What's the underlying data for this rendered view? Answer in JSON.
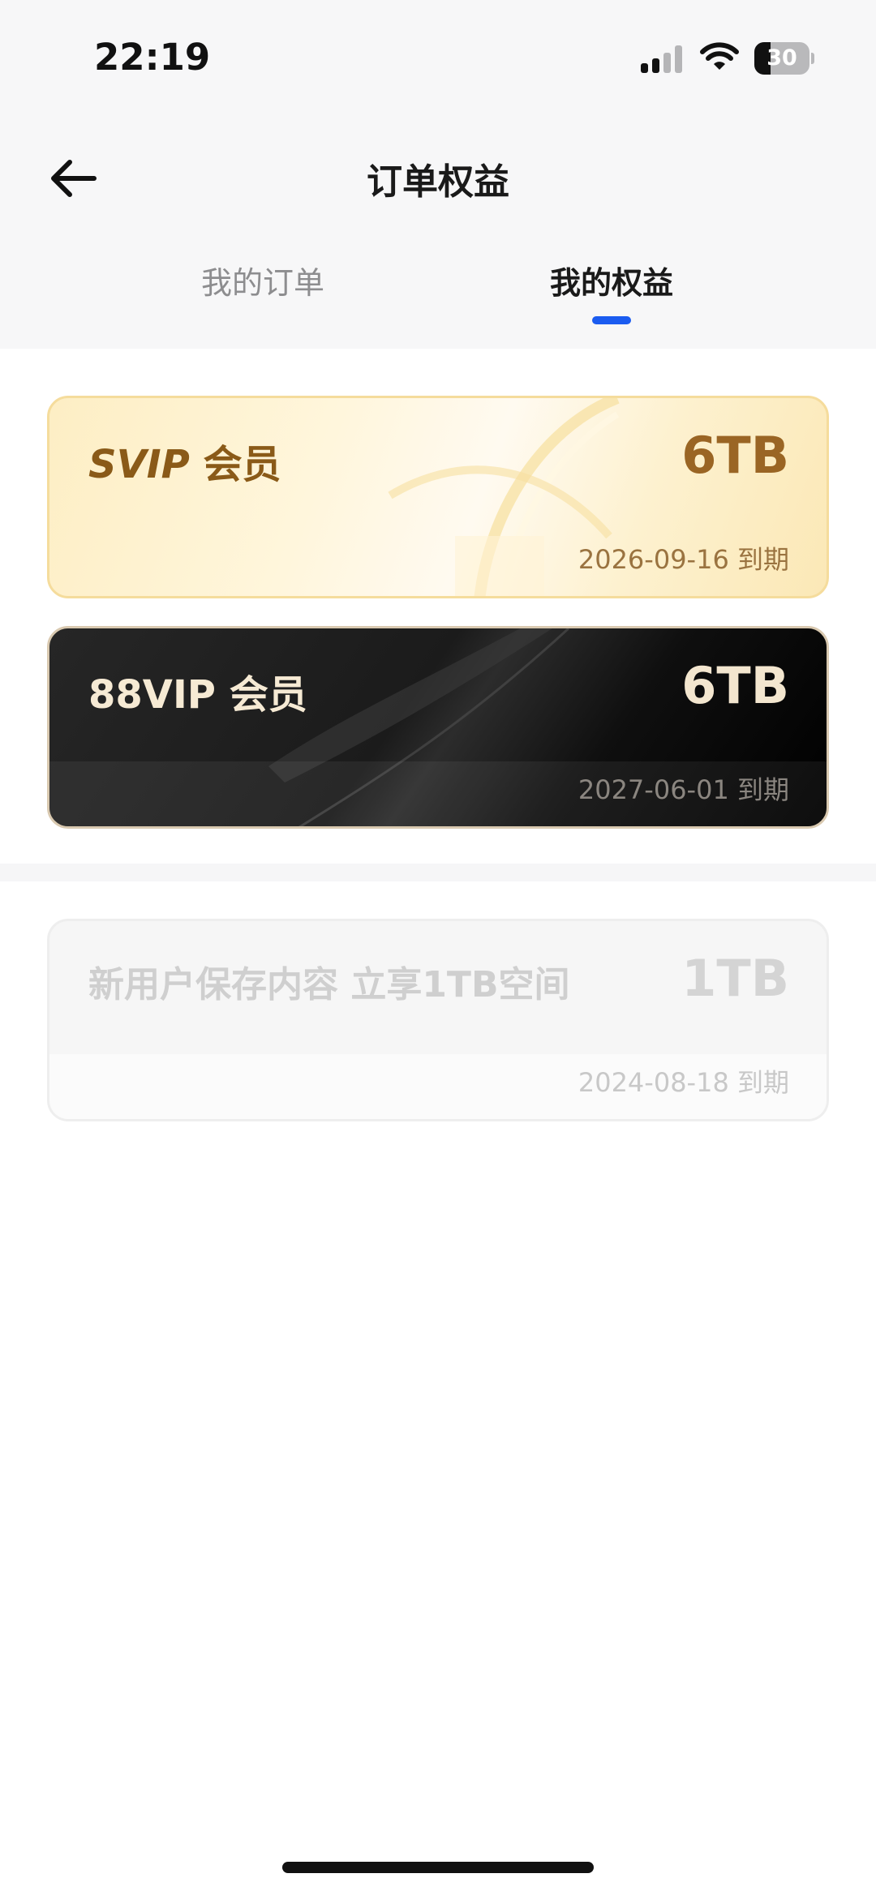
{
  "status_bar": {
    "time": "22:19",
    "battery_level": "30",
    "icons": [
      "signal-icon",
      "wifi-icon",
      "battery-icon"
    ]
  },
  "header": {
    "back_icon": "arrow-left-icon",
    "title": "订单权益"
  },
  "tabs": [
    {
      "label": "我的订单",
      "active": false
    },
    {
      "label": "我的权益",
      "active": true
    }
  ],
  "colors": {
    "accent": "#1b5cf0",
    "svip_gold": "#9a6524",
    "vip88_dark": "#111111"
  },
  "benefits": [
    {
      "name_prefix": "SVIP",
      "name_suffix": "会员",
      "capacity": "6TB",
      "expiry": "2026-09-16 到期"
    },
    {
      "name": "88VIP 会员",
      "capacity": "6TB",
      "expiry": "2027-06-01 到期"
    }
  ],
  "expired_benefits": [
    {
      "name": "新用户保存内容 立享1TB空间",
      "capacity": "1TB",
      "expiry": "2024-08-18 到期"
    }
  ]
}
